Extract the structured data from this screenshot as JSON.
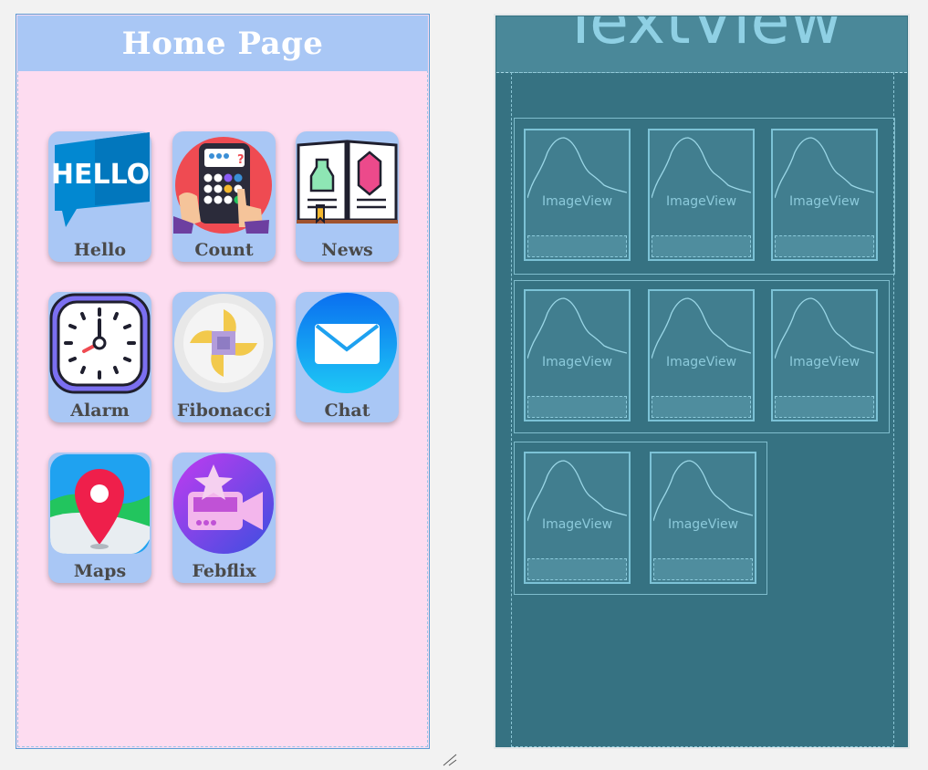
{
  "design": {
    "title": "Home Page",
    "apps": [
      {
        "label": "Hello",
        "icon": "hello-speech-bubble-icon"
      },
      {
        "label": "Count",
        "icon": "calculator-icon"
      },
      {
        "label": "News",
        "icon": "open-book-icon"
      },
      {
        "label": "Alarm",
        "icon": "clock-icon"
      },
      {
        "label": "Fibonacci",
        "icon": "pinwheel-icon"
      },
      {
        "label": "Chat",
        "icon": "envelope-icon"
      },
      {
        "label": "Maps",
        "icon": "map-pin-icon"
      },
      {
        "label": "Febflix",
        "icon": "video-camera-star-icon"
      }
    ]
  },
  "blueprint": {
    "title": "TextView",
    "image_placeholder": "ImageView"
  },
  "colors": {
    "design_bg": "#fddcf0",
    "header_bg": "#a9c7f5",
    "tile_bg": "#a9c7f5",
    "blueprint_bg": "#367282"
  }
}
